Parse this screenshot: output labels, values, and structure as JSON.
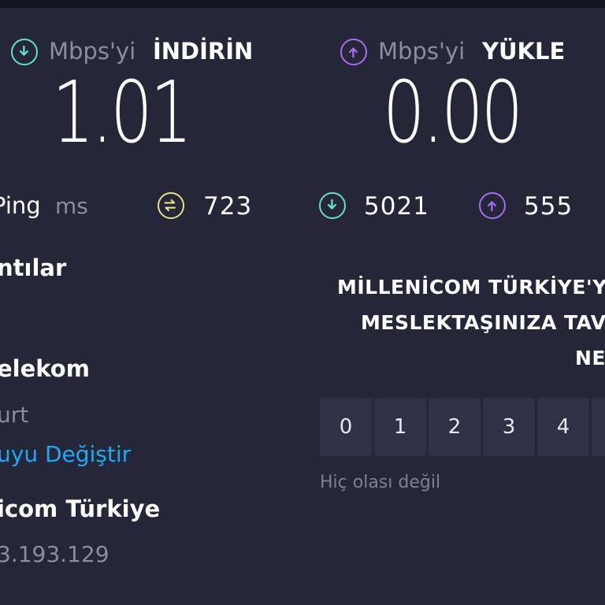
{
  "download": {
    "unit": "Mbps'yi",
    "title": "İNDİRİN",
    "value": "1.01",
    "icon": "download-arrow-icon",
    "color": "#5fe1d3"
  },
  "upload": {
    "unit": "Mbps'yi",
    "title": "YÜKLE",
    "value": "0.00",
    "icon": "upload-arrow-icon",
    "color": "#a66ef0"
  },
  "ping": {
    "label": "Ping",
    "unit": "ms",
    "jitter_value": "723",
    "jitter_icon": "ping-jitter-icon",
    "download_value": "5021",
    "upload_value": "555"
  },
  "connections": {
    "heading": "ntılar",
    "provider_name": "elekom",
    "provider_location": "urt",
    "change_server_link": "uyu Değiştir",
    "isp_name": "icom Türkiye",
    "ip_address": "3.193.129"
  },
  "survey": {
    "question_lines": [
      "MİLLENİCOM TÜRKİYE'Y",
      "MESLEKTAŞINIZA TAVS",
      "NE"
    ],
    "ratings": [
      "0",
      "1",
      "2",
      "3",
      "4",
      ""
    ],
    "low_label": "Hiç olası değil"
  }
}
